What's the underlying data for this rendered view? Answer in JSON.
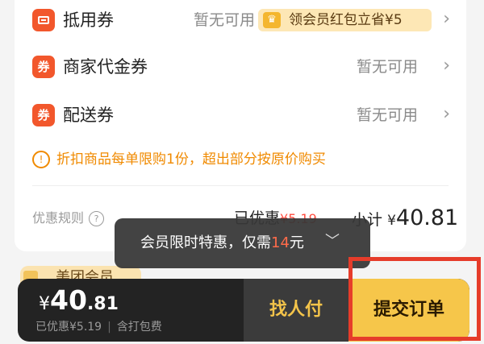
{
  "coupons": [
    {
      "label": "抵用券",
      "value": "暂无可用",
      "icon": "red-envelope-icon"
    },
    {
      "label": "商家代金券",
      "value": "暂无可用",
      "icon": "coupon-tag-icon"
    },
    {
      "label": "配送券",
      "value": "暂无可用",
      "icon": "coupon-tag-icon"
    }
  ],
  "vip_promo": {
    "text": "领会员红包立省¥5",
    "icon": "crown-icon"
  },
  "notice": "折扣商品每单限购1份，超出部分按原价购买",
  "summary": {
    "rules_label": "优惠规则",
    "saved_prefix": "已优惠",
    "saved_amount": "¥5.19",
    "subtotal_label": "小计",
    "subtotal_currency": "¥",
    "subtotal_amount": "40.81"
  },
  "tooltip": {
    "prefix": "会员限时特惠，仅需",
    "amount": "14",
    "suffix": "元"
  },
  "vip_strip_label": "美团会员",
  "bottom_bar": {
    "currency": "¥",
    "price_int": "40",
    "price_dec": ".81",
    "saved_text": "已优惠¥5.19",
    "delivery_text": "含打包费",
    "friend_pay_label": "找人付",
    "submit_label": "提交订单"
  },
  "colors": {
    "accent": "#f6c64a",
    "coupon_icon": "#f2572c",
    "notice": "#f08a00",
    "highlight": "#e63c2a"
  }
}
